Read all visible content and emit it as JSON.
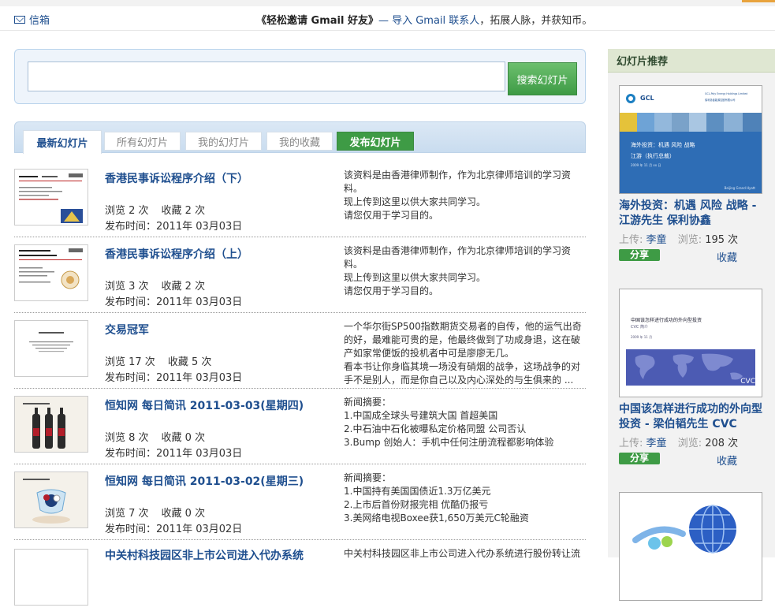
{
  "header": {
    "mailbox_label": "信箱",
    "invite_title": "《轻松邀请 Gmail 好友》",
    "invite_link": "— 导入 Gmail 联系人",
    "invite_suffix": "，拓展人脉，并获知币。"
  },
  "search": {
    "value": "",
    "button_label": "搜索幻灯片"
  },
  "tabs": [
    {
      "label": "最新幻灯片",
      "active": true
    },
    {
      "label": "所有幻灯片",
      "active": false
    },
    {
      "label": "我的幻灯片",
      "active": false
    },
    {
      "label": "我的收藏",
      "active": false
    },
    {
      "label": "发布幻灯片",
      "active": false
    }
  ],
  "list": {
    "items": [
      {
        "title": "香港民事诉讼程序介绍（下）",
        "views": "浏览 2 次",
        "favs": "收藏 2 次",
        "date": "发布时间：2011年 03月03日",
        "desc": [
          "该资料是由香港律师制作，作为北京律师培训的学习资料。",
          "现上传到这里以供大家共同学习。",
          "请您仅用于学习目的。"
        ]
      },
      {
        "title": "香港民事诉讼程序介绍（上）",
        "views": "浏览 3 次",
        "favs": "收藏 2 次",
        "date": "发布时间：2011年 03月03日",
        "desc": [
          "该资料是由香港律师制作，作为北京律师培训的学习资料。",
          "现上传到这里以供大家共同学习。",
          "请您仅用于学习目的。"
        ]
      },
      {
        "title": "交易冠军",
        "views": "浏览 17 次",
        "favs": "收藏 5 次",
        "date": "发布时间：2011年 03月03日",
        "desc": [
          "一个华尔街SP500指数期货交易者的自传，他的运气出奇的好，最难能可贵的是，他最终做到了功成身退，这在破产如家常便饭的投机者中可是廖廖无几。",
          "看本书让你身临其境一场没有硝烟的战争，这场战争的对手不是别人，而是你自己以及内心深处的与生俱来的 ..."
        ]
      },
      {
        "title": "恒知网 每日简讯 2011-03-03(星期四)",
        "views": "浏览 8 次",
        "favs": "收藏 0 次",
        "date": "发布时间：2011年 03月03日",
        "desc": [
          "新闻摘要：",
          "1.中国成全球头号建筑大国 首超美国",
          "2.中石油中石化被曝私定价格同盟 公司否认",
          "3.Bump 创始人：手机中任何注册流程都影响体验"
        ]
      },
      {
        "title": "恒知网 每日简讯 2011-03-02(星期三)",
        "views": "浏览 7 次",
        "favs": "收藏 0 次",
        "date": "发布时间：2011年 03月02日",
        "desc": [
          "新闻摘要：",
          "1.中国持有美国国债近1.3万亿美元",
          "2.上市后首份财报完相 优酷仍报亏",
          "3.美网络电视Boxee获1,650万美元C轮融资"
        ]
      },
      {
        "title": "中关村科技园区非上市公司进入代办系统",
        "views": "",
        "favs": "",
        "date": "",
        "desc": [
          "中关村科技园区非上市公司进入代办系统进行股份转让流"
        ]
      }
    ]
  },
  "sidebar": {
    "heading": "幻灯片推荐",
    "items": [
      {
        "title": "海外投资：机遇 风险 战略 - 江游先生 保利协鑫",
        "uploader_label": "上传:",
        "uploader": "李童",
        "views_label": "浏览:",
        "views": "195 次",
        "share": "分享",
        "fav": "收藏",
        "thumb_text_logo": "GCL",
        "thumb_text_company": "GCL-Poly Energy Holdings Limited",
        "thumb_text_cn_company": "保利协鑫能源控股有限公司",
        "thumb_text_heading": "海外投资：机遇 风险 战略",
        "thumb_text_sub": "江游（执行总裁）",
        "thumb_text_date": "2009 年 11 月 xx 日",
        "thumb_text_footer": "Beijing Grand Hyatt"
      },
      {
        "title": "中国该怎样进行成功的外向型投资 - 梁伯韬先生 CVC",
        "uploader_label": "上传:",
        "uploader": "李童",
        "views_label": "浏览:",
        "views": "208 次",
        "share": "分享",
        "fav": "收藏",
        "thumb_text_heading": "中国该怎样进行成功的外向型投资",
        "thumb_text_sub": "CVC 简介",
        "thumb_text_date": "2009 年 11 月",
        "thumb_text_logo": "CVC"
      }
    ]
  },
  "colors": {
    "link_blue": "#1f4f8f",
    "green_button": "#3e9b45",
    "search_panel_bg": "#eef4fb",
    "sidebar_bg": "#f2f2f2"
  }
}
